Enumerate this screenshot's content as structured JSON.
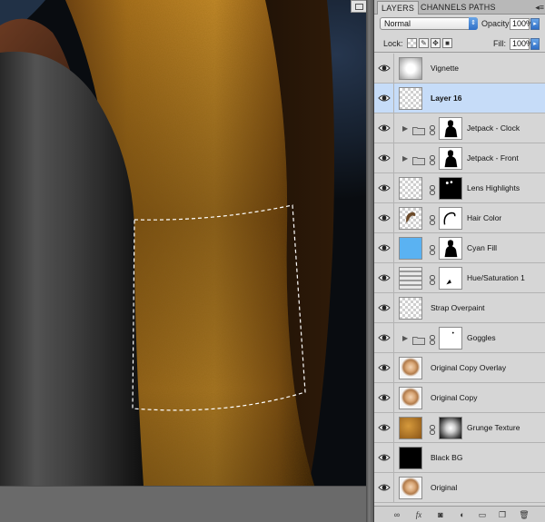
{
  "panel": {
    "tabs": [
      {
        "label": "LAYERS",
        "active": true
      },
      {
        "label": "CHANNELS",
        "active": false
      },
      {
        "label": "PATHS",
        "active": false
      }
    ],
    "menu_glyph": "◂≡",
    "blend_mode": "Normal",
    "opacity_label": "Opacity:",
    "opacity_value": "100%",
    "lock_label": "Lock:",
    "fill_label": "Fill:",
    "fill_value": "100%"
  },
  "layers": [
    {
      "name": "Vignette",
      "selected": false,
      "thumb": "vignette",
      "mask": null,
      "group": false
    },
    {
      "name": "Layer 16",
      "selected": true,
      "thumb": "transparent",
      "mask": null,
      "group": false
    },
    {
      "name": "Jetpack - Clock",
      "selected": false,
      "thumb": null,
      "mask": "silhouette",
      "group": true
    },
    {
      "name": "Jetpack - Front",
      "selected": false,
      "thumb": null,
      "mask": "silhouette",
      "group": true
    },
    {
      "name": "Lens Highlights",
      "selected": false,
      "thumb": "transparent",
      "mask": "dots",
      "group": false
    },
    {
      "name": "Hair Color",
      "selected": false,
      "thumb": "hair",
      "mask": "hairmask",
      "group": false
    },
    {
      "name": "Cyan Fill",
      "selected": false,
      "thumb": "cyan",
      "mask": "silhouette",
      "group": false
    },
    {
      "name": "Hue/Saturation 1",
      "selected": false,
      "thumb": "huesat",
      "mask": "corner",
      "group": false
    },
    {
      "name": "Strap Overpaint",
      "selected": false,
      "thumb": "transparent",
      "mask": null,
      "group": false
    },
    {
      "name": "Goggles",
      "selected": false,
      "thumb": null,
      "mask": "dot",
      "group": true
    },
    {
      "name": "Original Copy Overlay",
      "selected": false,
      "thumb": "portrait",
      "mask": null,
      "group": false
    },
    {
      "name": "Original Copy",
      "selected": false,
      "thumb": "portrait",
      "mask": null,
      "group": false
    },
    {
      "name": "Grunge Texture",
      "selected": false,
      "thumb": "grunge",
      "mask": "radial",
      "group": false
    },
    {
      "name": "Black BG",
      "selected": false,
      "thumb": "black",
      "mask": null,
      "group": false
    },
    {
      "name": "Original",
      "selected": false,
      "thumb": "portrait",
      "mask": null,
      "group": false
    }
  ],
  "colors": {
    "selection_highlight": "#c6dcf8",
    "cyan_fill": "#5ab2f2",
    "panel_bg": "#d6d6d6"
  },
  "footer_icons": [
    "link-icon",
    "fx-icon",
    "mask-icon",
    "adjustment-icon",
    "folder-icon",
    "new-layer-icon",
    "trash-icon"
  ]
}
